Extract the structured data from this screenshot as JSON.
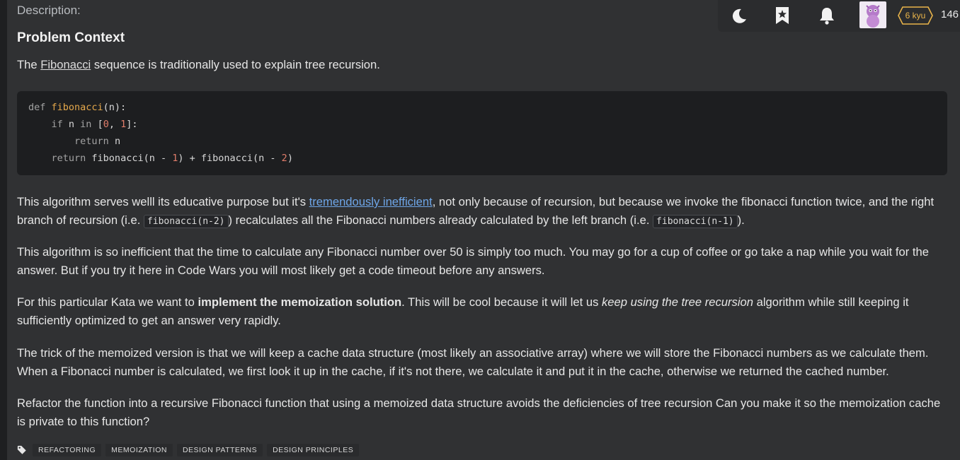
{
  "description_label": "Description:",
  "heading": "Problem Context",
  "intro": {
    "before": "The ",
    "link": "Fibonacci",
    "after": " sequence is traditionally used to explain tree recursion."
  },
  "code": {
    "line1": {
      "kw": "def ",
      "fn": "fibonacci",
      "rest": "(n):"
    },
    "line2": {
      "indent": "    ",
      "kw1": "if",
      "mid1": " n ",
      "kw2": "in",
      "mid2": " [",
      "num1": "0",
      "sep": ", ",
      "num2": "1",
      "end": "]:"
    },
    "line3": {
      "indent": "        ",
      "kw": "return",
      "rest": " n"
    },
    "line4": {
      "indent": "    ",
      "kw": "return",
      "mid": " fibonacci(n - ",
      "num1": "1",
      "mid2": ") + fibonacci(n - ",
      "num2": "2",
      "end": ")"
    }
  },
  "para1": {
    "t1": "This algorithm serves welll its educative purpose but it's ",
    "link": "tremendously inefficient",
    "t2": ", not only because of recursion, but because we invoke the fibonacci function twice, and the right branch of recursion (i.e. ",
    "code1": "fibonacci(n-2)",
    "t3": ") recalculates all the Fibonacci numbers already calculated by the left branch (i.e. ",
    "code2": "fibonacci(n-1)",
    "t4": ")."
  },
  "para2": "This algorithm is so inefficient that the time to calculate any Fibonacci number over 50 is simply too much. You may go for a cup of coffee or go take a nap while you wait for the answer. But if you try it here in Code Wars you will most likely get a code timeout before any answers.",
  "para3": {
    "t1": "For this particular Kata we want to ",
    "bold": "implement the memoization solution",
    "t2": ". This will be cool because it will let us ",
    "italic": "keep using the tree recursion",
    "t3": " algorithm while still keeping it sufficiently optimized to get an answer very rapidly."
  },
  "para4": "The trick of the memoized version is that we will keep a cache data structure (most likely an associative array) where we will store the Fibonacci numbers as we calculate them. When a Fibonacci number is calculated, we first look it up in the cache, if it's not there, we calculate it and put it in the cache, otherwise we returned the cached number.",
  "para5": "Refactor the function into a recursive Fibonacci function that using a memoized data structure avoids the deficiencies of tree recursion Can you make it so the memoization cache is private to this function?",
  "tags": [
    "REFACTORING",
    "MEMOIZATION",
    "DESIGN PATTERNS",
    "DESIGN PRINCIPLES"
  ],
  "topbar": {
    "icons": [
      "moon-icon",
      "bookmark-star-icon",
      "bell-icon"
    ],
    "rank": "6 kyu",
    "honor": "146",
    "rank_color": "#e9b44a"
  }
}
